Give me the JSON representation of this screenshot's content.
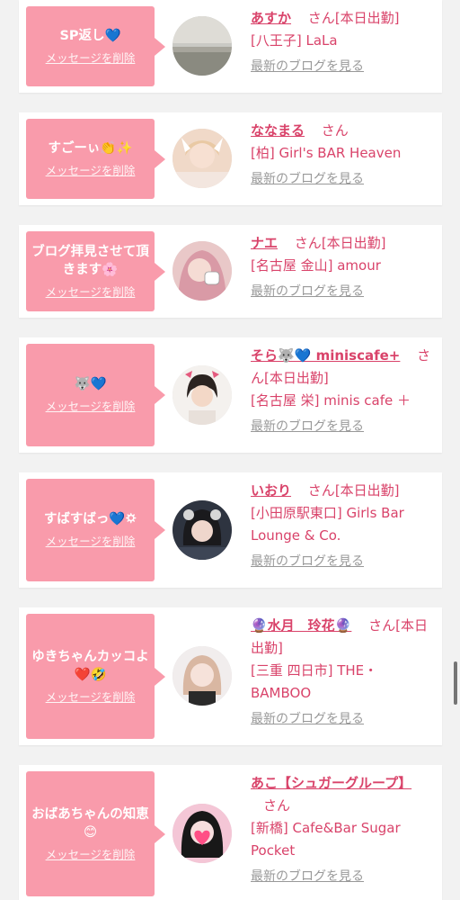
{
  "delete_label": "メッセージを削除",
  "blog_label": "最新のブログを見る",
  "san_label": "さん",
  "cards": [
    {
      "message": "SP返し💙",
      "name": "あすか",
      "status": "[本日出勤]",
      "store": "[八王子] LaLa"
    },
    {
      "message": "すごーぃ👏✨",
      "name": "ななまる",
      "status": "",
      "store": "[柏] Girl's BAR Heaven"
    },
    {
      "message": "ブログ拝見させて頂きます🌸",
      "name": "ナエ",
      "status": "[本日出勤]",
      "store": "[名古屋 金山] amour"
    },
    {
      "message": "🐺💙",
      "name": "そら🐺💙 miniscafe+",
      "status": "[本日出勤]",
      "store": "[名古屋 栄] minis cafe ＋"
    },
    {
      "message": "すばすばっ💙🌣",
      "name": "いおり",
      "status": "[本日出勤]",
      "store": "[小田原駅東口] Girls Bar Lounge & Co."
    },
    {
      "message": "ゆきちゃんカッコよ❤️🤣",
      "name": "🔮水月　玲花🔮",
      "status": "[本日出勤]",
      "store": "[三重 四日市] THE・BAMBOO"
    },
    {
      "message": "おばあちゃんの知恵😊",
      "name": "あこ【シュガーグループ】",
      "status": "",
      "store": "[新橋] Cafe&Bar Sugar Pocket"
    }
  ]
}
